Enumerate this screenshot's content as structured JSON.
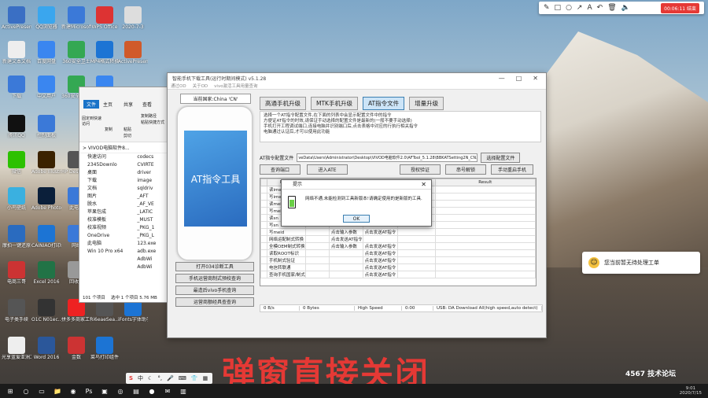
{
  "toolbar": {
    "rec_label": "00:06:11 结束"
  },
  "desktop_icons": [
    {
      "label": "ActivePresente...",
      "color": "#3a6fc4"
    },
    {
      "label": "QQ浏览器",
      "color": "#3aa6ee"
    },
    {
      "label": "新建Microsoft",
      "color": "#3b79d8"
    },
    {
      "label": "WPS Office",
      "color": "#d33"
    },
    {
      "label": "2020-7-3",
      "color": "#ddd"
    },
    {
      "label": "新建文本文档",
      "color": "#eee"
    },
    {
      "label": "百度网盘",
      "color": "#3a86f0"
    },
    {
      "label": "360安全卫士",
      "color": "#34a853"
    },
    {
      "label": "MP4格式转换",
      "color": "#1c74d4"
    },
    {
      "label": "ActivePresen.",
      "color": "#d05a2a"
    },
    {
      "label": "下载",
      "color": "#3b79d8"
    },
    {
      "label": "中文用户",
      "color": "#3a86f0"
    },
    {
      "label": "360安全浏览器",
      "color": "#34a853"
    },
    {
      "label": "360压缩",
      "color": "#3a86f0"
    },
    {
      "label": "腾讯QQ",
      "color": "#111"
    },
    {
      "label": "控制面板",
      "color": "#3b79d8"
    },
    {
      "label": "微信",
      "color": "#2dc100"
    },
    {
      "label": "Adobe Illustrat...",
      "color": "#3b2200"
    },
    {
      "label": "HP Deskjet 1110 series",
      "color": "#555"
    },
    {
      "label": "小鸟壁纸",
      "color": "#3ab0e0"
    },
    {
      "label": "Adobe Photosh...",
      "color": "#0b1f3a"
    },
    {
      "label": "此电脑",
      "color": "#3b79d8"
    },
    {
      "label": "摩拍一键还原",
      "color": "#2a6bbf"
    },
    {
      "label": "CAINIAO打印组件",
      "color": "#1c74d4"
    },
    {
      "label": "网络",
      "color": "#3b79d8"
    },
    {
      "label": "电商三哥",
      "color": "#c33"
    },
    {
      "label": "Excel 2016",
      "color": "#217346"
    },
    {
      "label": "回收站",
      "color": "#999"
    },
    {
      "label": "电子类手续",
      "color": "#555"
    },
    {
      "label": "O1C N01ec...",
      "color": "#333"
    },
    {
      "label": "拼多多商家工作台",
      "color": "#e22"
    },
    {
      "label": "Ri6eaeSea...",
      "color": "#555"
    },
    {
      "label": "iFonts字体助手",
      "color": "#1c74d4"
    },
    {
      "label": "光享蓝爱亚洲工具",
      "color": "#eee"
    },
    {
      "label": "Word 2016",
      "color": "#2b579a"
    },
    {
      "label": "金数",
      "color": "#c33"
    },
    {
      "label": "菜鸟打印组件",
      "color": "#1c74d4"
    }
  ],
  "explorer": {
    "file_tab": "文件",
    "tabs": [
      "主页",
      "共享",
      "查看"
    ],
    "actions": [
      "固定到快速访问",
      "复制",
      "粘贴",
      "复制路径",
      "粘贴快捷方式",
      "剪切"
    ],
    "path": "> VIVOD电脑软件8...",
    "nav": [
      "快速访问",
      "2345Downlo",
      "桌面",
      "下载",
      "文档",
      "图片",
      "脱水",
      "苹果包成",
      "校准模板",
      "校准视频",
      "OneDrive",
      "此电脑",
      "Win 10 Pro x64"
    ],
    "files": [
      "codecs",
      "CVIRTE",
      "driver",
      "image",
      "sqldriv",
      "_AFT",
      "_AF_VE",
      "_LATIC",
      "_MUST",
      "_PKG_1",
      "_PKG_L",
      "123.exe",
      "adb.exe",
      "AdbWi",
      "AdbWi"
    ],
    "status": "101 个项目",
    "selected": "选中 1 个项目 5.76 MB"
  },
  "app": {
    "title": "智能手机下载工具(运行时期间模式)  v5.1.28",
    "menu": [
      "通过OD",
      "关于OD",
      "vivo激活工具用量查询"
    ],
    "country": "当前国家:China 'CN'",
    "phone_screen": "AT指令工具",
    "left_buttons": [
      "打开034诊断工具",
      "手机运营商制式预校查询",
      "最造后vivo手机查询",
      "运营商额经具查查询"
    ],
    "tabs": [
      "高通手机升级",
      "MTK手机升级",
      "AT指令文件",
      "增量升级"
    ],
    "description": [
      "选择一个AT指令配置文件,在下面的列表中会显示配置文件中的指令",
      "方便证AT指令的时效,请保证手动选择的配置文件是最新的(一般不要手动选择)",
      "手机打开工程调试端口,连接电脑并识别端口后,点击表格中对应的行执行相关指令",
      "电脑通过认证后,才可以使用此功能"
    ],
    "config_label": "AT指令配置文件",
    "config_path": "veData\\Users\\Administrator\\Desktop\\VIVOD电脑软件2.0\\AFTool_5.1.28\\BBKATSetting2N_CN.bin",
    "select_btn": "选择配置文件",
    "row2": [
      "查询端口",
      "进入ATE",
      "授权验证",
      "串号解锁",
      "手动重启手机"
    ],
    "columns": [
      "",
      "Name",
      "Status",
      "Param",
      "ActionType",
      "ActionResult",
      "Result"
    ],
    "rows": [
      [
        "",
        "读imei",
        "",
        "",
        "",
        "",
        ""
      ],
      [
        "",
        "写imei",
        "",
        "",
        "",
        "",
        ""
      ],
      [
        "",
        "读meid",
        "",
        "",
        "",
        "",
        ""
      ],
      [
        "",
        "写meid",
        "",
        "",
        "",
        "",
        ""
      ],
      [
        "",
        "读sn",
        "",
        "",
        "",
        "",
        ""
      ],
      [
        "",
        "写sn",
        "",
        "",
        "",
        "",
        ""
      ],
      [
        "",
        "写meid",
        "",
        "点击输入参数",
        "点击发送AT指令",
        "",
        ""
      ],
      [
        "",
        "网络运配制式转换",
        "",
        "点击发送AT指令",
        "",
        "",
        ""
      ],
      [
        "",
        "全模OEM制式转换",
        "",
        "点击输入参数",
        "点击发送AT指令",
        "",
        ""
      ],
      [
        "",
        "读取ROOT标识",
        "",
        "",
        "点击发送AT指令",
        "",
        ""
      ],
      [
        "",
        "手机制式验证",
        "",
        "",
        "点击发送AT指令",
        "",
        ""
      ],
      [
        "",
        "电信转联通",
        "",
        "",
        "点击发送AT指令",
        "",
        ""
      ],
      [
        "",
        "查询手机国家/制式",
        "",
        "",
        "点击发送AT指令",
        "",
        ""
      ]
    ],
    "status": [
      "0 B/s",
      "0 Bytes",
      "High Speed",
      "0:00",
      "USB: DA Download All(high speed,auto detect)"
    ]
  },
  "dialog": {
    "title": "提示",
    "message": "网络不通,未能检测到工具新版本!请确定使用的是新版的工具.",
    "ok": "OK"
  },
  "caption": "弹窗直接关闭",
  "notification": "您当前暂无待处理工单",
  "taskbar": {
    "time": "9:01",
    "date": "2020/7/15"
  },
  "watermark": "4567 技术论坛"
}
